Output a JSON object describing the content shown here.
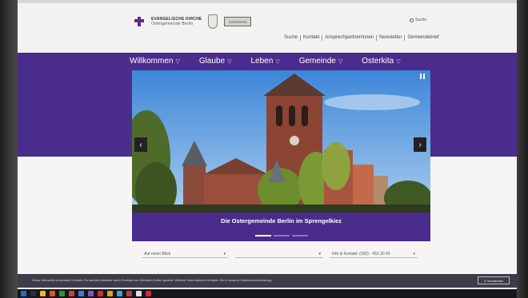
{
  "header": {
    "logo_line1": "EVANGELISCHE KIRCHE",
    "logo_line2": "Ostergemeinde Berlin",
    "badge": "OSTERKITA",
    "search_label": "Suche",
    "util_links": [
      "Suche",
      "Kontakt",
      "Ansprechpartner/innen",
      "Newsletter",
      "Gemeindebrief"
    ]
  },
  "nav": {
    "items": [
      {
        "label": "Willkommen"
      },
      {
        "label": "Glaube"
      },
      {
        "label": "Leben"
      },
      {
        "label": "Gemeinde"
      },
      {
        "label": "Osterkita"
      }
    ]
  },
  "hero": {
    "caption": "Die Ostergemeinde Berlin im Sprengelkiez",
    "slides": 3,
    "active_slide": 1
  },
  "selects": {
    "a": "Auf einen Blick",
    "b": "",
    "c": "Info & Kontakt: (030) - 453 30 43"
  },
  "cookie": {
    "text": "Diese Webseite verwendet Cookies. Es werden teilweise auch Cookies von Diensten Dritter gesetzt. Weitere Informationen erhalten Sie in unserer Datenschutzerklärung.",
    "button": "X Verstanden"
  },
  "colors": {
    "brand_purple": "#4a2c8c",
    "taskbar": "#14161c"
  }
}
